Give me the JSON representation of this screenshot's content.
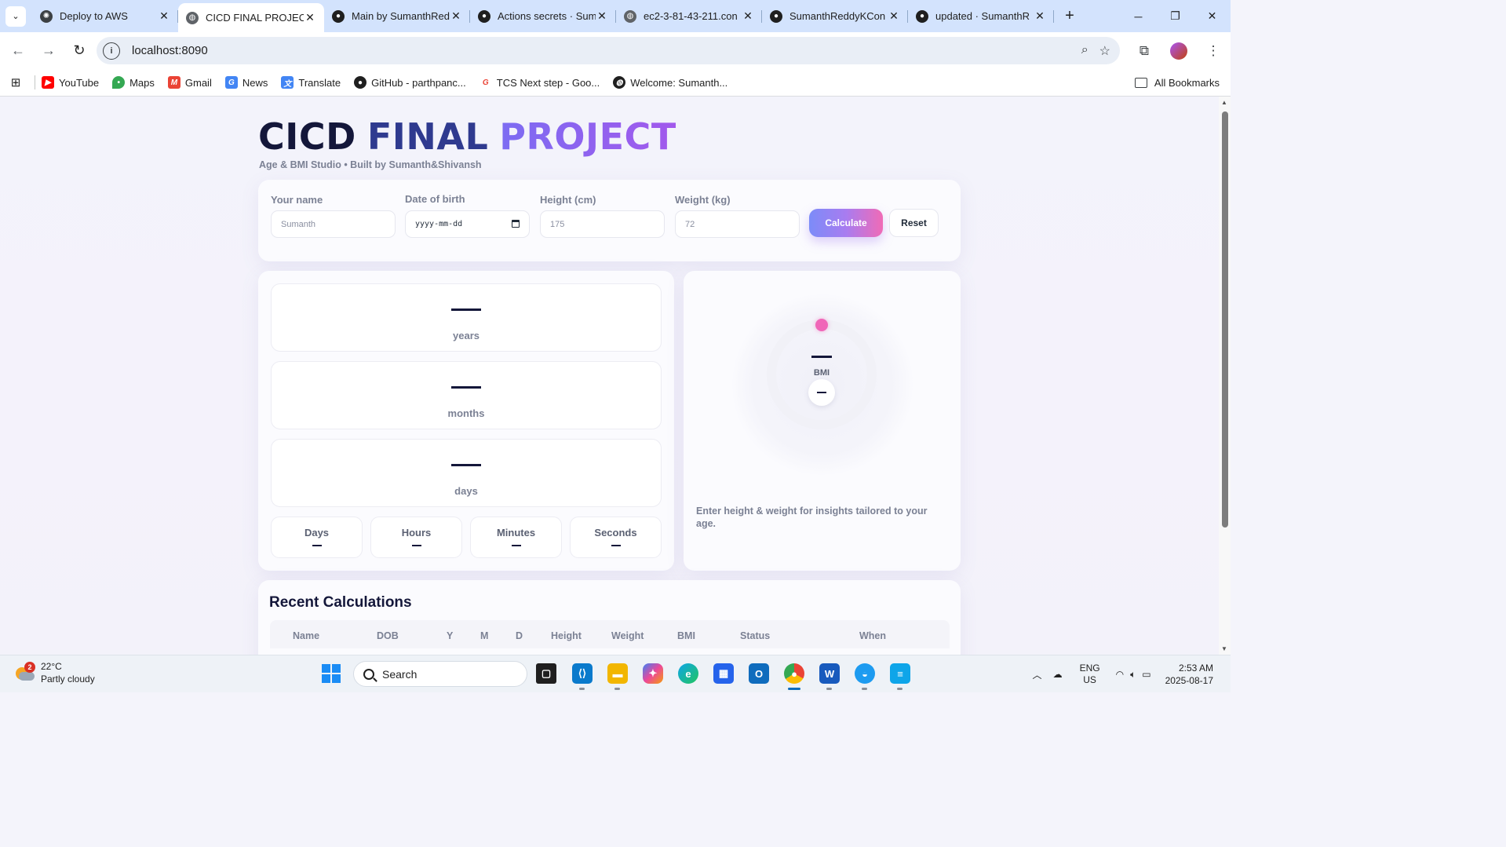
{
  "browser": {
    "tabs": [
      {
        "title": "Deploy to AWS",
        "icon": "openai-icon",
        "active": false
      },
      {
        "title": "CICD FINAL PROJECT",
        "icon": "globe-icon",
        "active": true
      },
      {
        "title": "Main by SumanthRed",
        "icon": "github-icon",
        "active": false
      },
      {
        "title": "Actions secrets · Sum",
        "icon": "github-icon",
        "active": false
      },
      {
        "title": "ec2-3-81-43-211.con",
        "icon": "globe-icon",
        "active": false
      },
      {
        "title": "SumanthReddyKCon",
        "icon": "github-icon",
        "active": false
      },
      {
        "title": "updated · SumanthR",
        "icon": "github-icon",
        "active": false
      }
    ],
    "url": "localhost:8090",
    "bookmarks": [
      {
        "label": "YouTube",
        "icon": "youtube-icon",
        "color": "#ff0000"
      },
      {
        "label": "Maps",
        "icon": "maps-icon",
        "color": "#34a853"
      },
      {
        "label": "Gmail",
        "icon": "gmail-icon",
        "color": "#ea4335"
      },
      {
        "label": "News",
        "icon": "news-icon",
        "color": "#4285f4"
      },
      {
        "label": "Translate",
        "icon": "translate-icon",
        "color": "#4285f4"
      },
      {
        "label": "GitHub - parthpanc...",
        "icon": "github-icon",
        "color": "#1f1f1f"
      },
      {
        "label": "TCS Next step - Goo...",
        "icon": "google-icon",
        "color": "#ffffff"
      },
      {
        "label": "Welcome: Sumanth...",
        "icon": "globe-icon",
        "color": "#1f1f1f"
      }
    ],
    "all_bookmarks": "All Bookmarks"
  },
  "page": {
    "title_words": [
      "CICD",
      "FINAL",
      "PROJECT"
    ],
    "subtitle": "Age & BMI Studio • Built by Sumanth&Shivansh",
    "form": {
      "name_label": "Your name",
      "name_placeholder": "Sumanth",
      "dob_label": "Date of birth",
      "dob_placeholder": "yyyy-mm-dd",
      "height_label": "Height (cm)",
      "height_placeholder": "175",
      "weight_label": "Weight (kg)",
      "weight_placeholder": "72",
      "calculate": "Calculate",
      "reset": "Reset"
    },
    "age": {
      "units": [
        "years",
        "months",
        "days"
      ],
      "mini": [
        "Days",
        "Hours",
        "Minutes",
        "Seconds"
      ]
    },
    "bmi": {
      "label": "BMI",
      "hint": "Enter height & weight for insights tailored to your age."
    },
    "recent": {
      "title": "Recent Calculations",
      "columns": [
        "Name",
        "DOB",
        "Y",
        "M",
        "D",
        "Height",
        "Weight",
        "BMI",
        "Status",
        "When"
      ]
    },
    "colors": {
      "accent_start": "#7c8cf8",
      "accent_end": "#f06bb6",
      "bmi_dot": "#f066b8"
    }
  },
  "taskbar": {
    "weather_temp": "22°C",
    "weather_desc": "Partly cloudy",
    "weather_badge": "2",
    "search": "Search",
    "lang_top": "ENG",
    "lang_bottom": "US",
    "time": "2:53 AM",
    "date": "2025-08-17"
  }
}
